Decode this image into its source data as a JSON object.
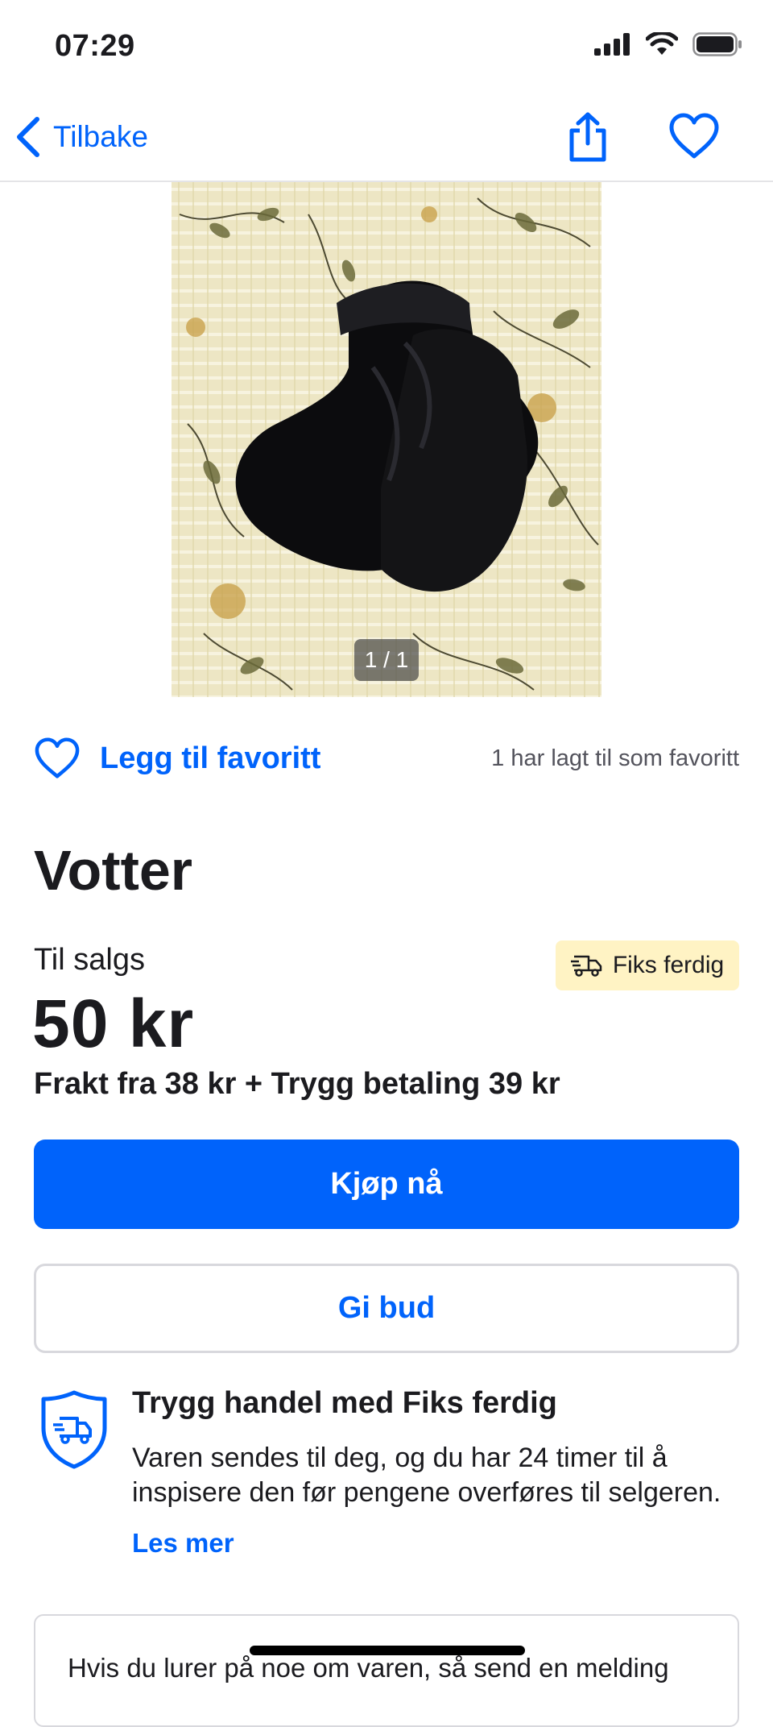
{
  "status_bar": {
    "time": "07:29"
  },
  "nav": {
    "back_label": "Tilbake"
  },
  "image": {
    "counter": "1 / 1"
  },
  "favorite": {
    "button_label": "Legg til favoritt",
    "count_text": "1 har lagt til som favoritt"
  },
  "listing": {
    "title": "Votter",
    "status": "Til salgs",
    "badge": "Fiks ferdig",
    "price": "50 kr",
    "shipping": "Frakt fra 38 kr + Trygg betaling 39 kr"
  },
  "actions": {
    "buy_label": "Kjøp nå",
    "bid_label": "Gi bud"
  },
  "safe_trade": {
    "title": "Trygg handel med Fiks ferdig",
    "text": "Varen sendes til deg, og du har 24 timer til å inspisere den før pengene overføres til selgeren.",
    "read_more": "Les mer"
  },
  "message": {
    "text": "Hvis du lurer på noe om varen, så send en melding"
  },
  "colors": {
    "accent": "#0063fb",
    "badge_bg": "#fff3c4"
  }
}
